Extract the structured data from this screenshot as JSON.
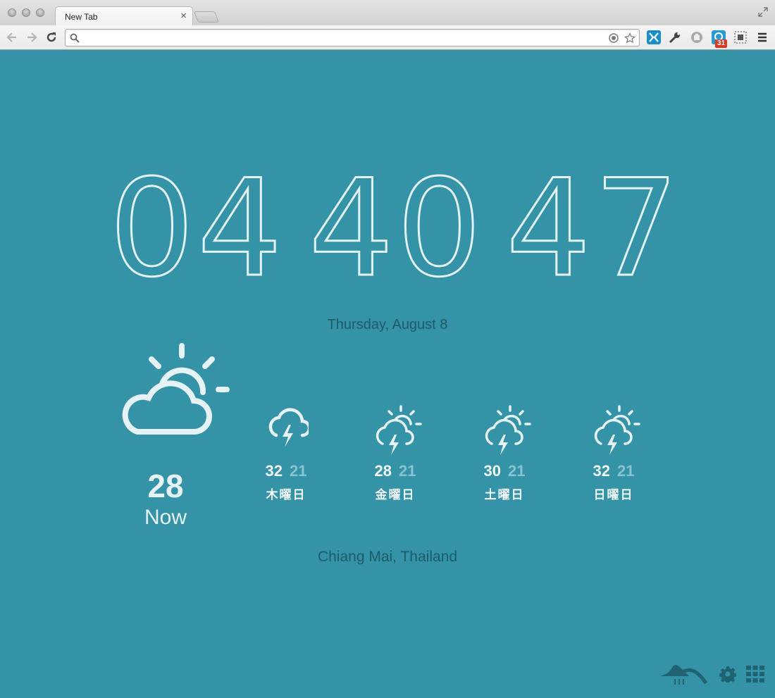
{
  "browser": {
    "tab_title": "New Tab",
    "tab_close": "×",
    "omnibox_value": "",
    "extension_badge": "31"
  },
  "clock": {
    "hours": "04",
    "minutes": "40",
    "seconds": "47"
  },
  "date": "Thursday, August 8",
  "current": {
    "temp": "28",
    "label": "Now",
    "icon": "partly-cloudy-icon"
  },
  "forecast": [
    {
      "hi": "32",
      "lo": "21",
      "day": "木曜日",
      "icon": "thunderstorm-icon"
    },
    {
      "hi": "28",
      "lo": "21",
      "day": "金曜日",
      "icon": "thunderstorm-sun-icon"
    },
    {
      "hi": "30",
      "lo": "21",
      "day": "土曜日",
      "icon": "thunderstorm-sun-icon"
    },
    {
      "hi": "32",
      "lo": "21",
      "day": "日曜日",
      "icon": "thunderstorm-sun-icon"
    }
  ],
  "location": "Chiang Mai, Thailand",
  "colors": {
    "background": "#3493a6",
    "text_dark": "#1d5b69",
    "text_light": "#e6f3f6",
    "temp_low": "#88c3cf"
  }
}
